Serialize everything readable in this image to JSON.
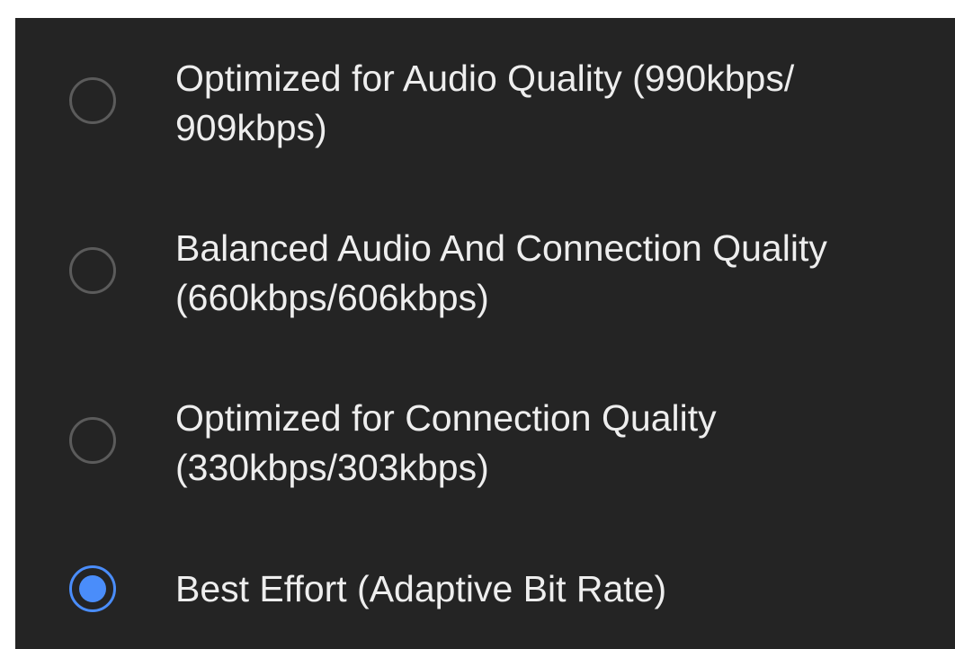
{
  "quality_options": [
    {
      "label": "Optimized for Audio Quality (990kbps/\n909kbps)",
      "selected": false
    },
    {
      "label": "Balanced Audio And Connection Quality\n(660kbps/606kbps)",
      "selected": false
    },
    {
      "label": "Optimized for Connection Quality\n(330kbps/303kbps)",
      "selected": false
    },
    {
      "label": "Best Effort (Adaptive Bit Rate)",
      "selected": true
    }
  ],
  "colors": {
    "background": "#242424",
    "accent": "#4a8dfa",
    "text": "#eeeeee",
    "radio_border": "#5b5b5b"
  }
}
